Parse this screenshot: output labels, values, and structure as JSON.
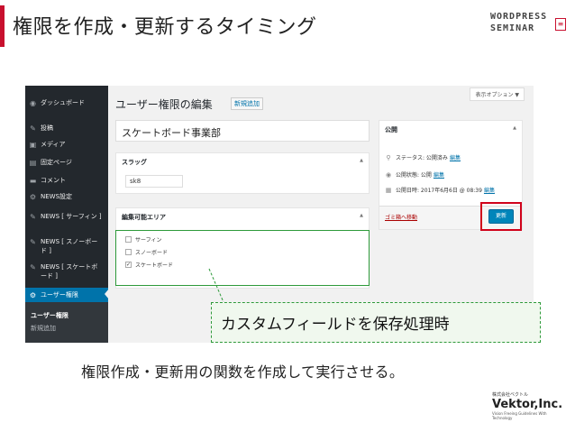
{
  "slide": {
    "title": "権限を作成・更新するタイミング",
    "brand_line1": "WORDPRESS",
    "brand_line2": "SEMINAR",
    "caption": "権限作成・更新用の関数を作成して実行させる。",
    "callout": "カスタムフィールドを保存処理時",
    "company": {
      "kabushiki": "株式会社ベクトル",
      "name": "Vektor,Inc.",
      "tagline": "Vision Freeing Guidelines With Technology"
    },
    "accent_color": "#c8102e"
  },
  "sidebar": {
    "items": [
      {
        "label": "ダッシュボード",
        "icon": "dashboard-icon",
        "glyph": "◉"
      },
      {
        "label": "投稿",
        "icon": "pin-icon",
        "glyph": "✎"
      },
      {
        "label": "メディア",
        "icon": "media-icon",
        "glyph": "▣"
      },
      {
        "label": "固定ページ",
        "icon": "page-icon",
        "glyph": "▤"
      },
      {
        "label": "コメント",
        "icon": "comment-icon",
        "glyph": "▬"
      },
      {
        "label": "NEWS設定",
        "icon": "gear-icon",
        "glyph": "⚙"
      },
      {
        "label": "NEWS [ サーフィン ]",
        "icon": "pin-icon",
        "glyph": "✎"
      },
      {
        "label": "NEWS [ スノーボード ]",
        "icon": "pin-icon",
        "glyph": "✎"
      },
      {
        "label": "NEWS [ スケートボード ]",
        "icon": "pin-icon",
        "glyph": "✎"
      },
      {
        "label": "ユーザー権限",
        "icon": "gear-icon",
        "glyph": "⚙"
      }
    ],
    "submenu": [
      "ユーザー権限",
      "新規追加"
    ]
  },
  "editor": {
    "heading": "ユーザー権限の編集",
    "add_new": "新規追加",
    "screen_options": "表示オプション ▼",
    "title_value": "スケートボード事業部",
    "slug_box": {
      "title": "スラッグ",
      "value": "sk8"
    },
    "area_box": {
      "title": "編集可能エリア",
      "options": [
        {
          "label": "サーフィン",
          "checked": false
        },
        {
          "label": "スノーボード",
          "checked": false
        },
        {
          "label": "スケートボード",
          "checked": true
        }
      ]
    },
    "toggle": "▲",
    "publish": {
      "title": "公開",
      "status_label": "ステータス: 公開済み",
      "status_link": "編集",
      "visibility_label": "公開状態: 公開",
      "visibility_link": "編集",
      "date_label": "公開日時: 2017年6月6日 @ 08:39",
      "date_link": "編集",
      "trash": "ゴミ箱へ移動",
      "update": "更新"
    }
  }
}
